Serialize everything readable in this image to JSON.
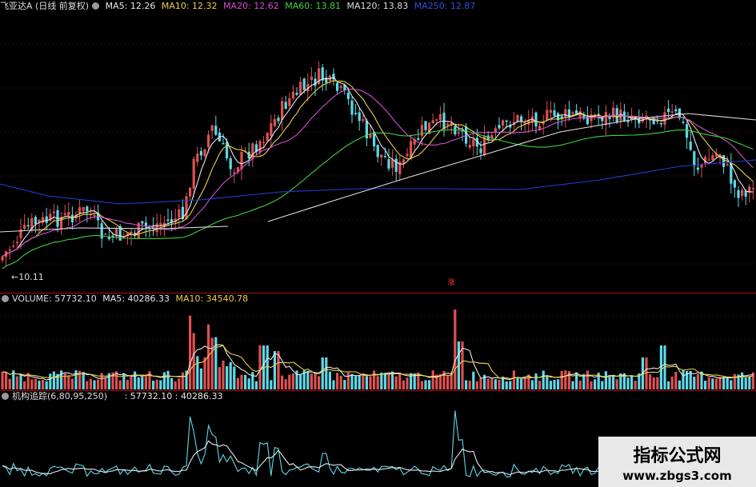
{
  "price_legend": {
    "title": "飞亚达A (日线 前复权)",
    "ma5": "MA5: 12.26",
    "ma10": "MA10: 12.32",
    "ma20": "MA20: 12.62",
    "ma60": "MA60: 13.81",
    "ma120": "MA120: 13.83",
    "ma250": "MA250: 12.87"
  },
  "price_low_label": "10.11",
  "price_marker_text": "涨",
  "volume_legend": {
    "title": "VOLUME: 57732.10",
    "ma5": "MA5: 40286.33",
    "ma10": "MA10: 34540.78"
  },
  "indicator_legend": {
    "title": "机构追踪(6,80,95,250)",
    "values": ": 57732.10 : 40286.33"
  },
  "watermark": {
    "title": "指标公式网",
    "url": "www.zbgs3.com"
  },
  "colors": {
    "up": "#e05050",
    "down": "#5fd8e8",
    "ma5": "#e8e8e8",
    "ma10": "#e8d04a",
    "ma20": "#d050d0",
    "ma60": "#40d040",
    "ma120": "#dddddd",
    "ma250": "#2040d0",
    "divider": "#a01010"
  }
}
